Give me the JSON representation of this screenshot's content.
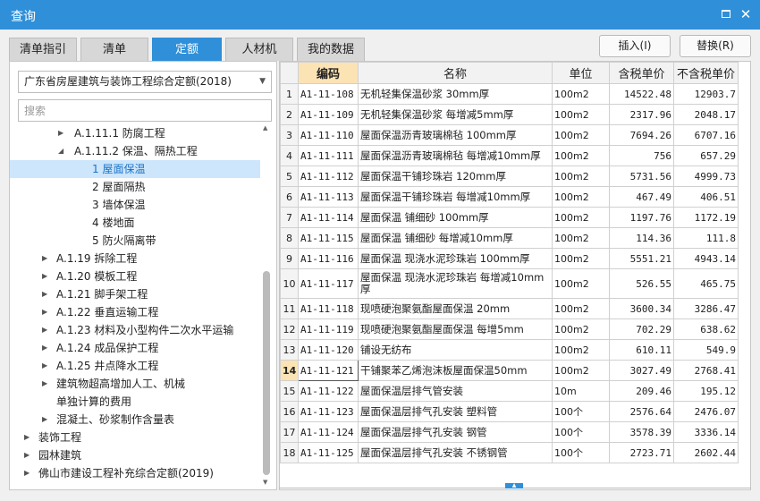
{
  "window": {
    "title": "查询"
  },
  "tabs": [
    {
      "label": "清单指引",
      "active": false
    },
    {
      "label": "清单",
      "active": false
    },
    {
      "label": "定额",
      "active": true
    },
    {
      "label": "人材机",
      "active": false
    },
    {
      "label": "我的数据",
      "active": false
    }
  ],
  "buttons": {
    "insert": "插入(I)",
    "replace": "替换(R)"
  },
  "left": {
    "quota_select": "广东省房屋建筑与装饰工程综合定额(2018)",
    "search_placeholder": "搜索"
  },
  "tree": [
    {
      "label": "A.1.11.1 防腐工程",
      "arrow": "▶"
    },
    {
      "label": "A.1.11.2 保温、隔热工程",
      "arrow": "◢"
    },
    {
      "label": "1 屋面保温",
      "arrow": "",
      "selected": true
    },
    {
      "label": "2 屋面隔热",
      "arrow": ""
    },
    {
      "label": "3 墙体保温",
      "arrow": ""
    },
    {
      "label": "4 楼地面",
      "arrow": ""
    },
    {
      "label": "5 防火隔离带",
      "arrow": ""
    },
    {
      "label": "A.1.19 拆除工程",
      "arrow": "▶"
    },
    {
      "label": "A.1.20 模板工程",
      "arrow": "▶"
    },
    {
      "label": "A.1.21 脚手架工程",
      "arrow": "▶"
    },
    {
      "label": "A.1.22 垂直运输工程",
      "arrow": "▶"
    },
    {
      "label": "A.1.23 材料及小型构件二次水平运输",
      "arrow": "▶"
    },
    {
      "label": "A.1.24 成品保护工程",
      "arrow": "▶"
    },
    {
      "label": "A.1.25 井点降水工程",
      "arrow": "▶"
    },
    {
      "label": "建筑物超高增加人工、机械",
      "arrow": "▶"
    },
    {
      "label": "单独计算的费用",
      "arrow": ""
    },
    {
      "label": "混凝土、砂浆制作含量表",
      "arrow": "▶"
    },
    {
      "label": "装饰工程",
      "arrow": "▶"
    },
    {
      "label": "园林建筑",
      "arrow": "▶"
    },
    {
      "label": "佛山市建设工程补充综合定额(2019)",
      "arrow": "▶"
    }
  ],
  "table": {
    "headers": [
      "",
      "编码",
      "名称",
      "单位",
      "含税单价",
      "不含税单价"
    ],
    "rows": [
      {
        "no": "1",
        "code": "A1-11-108",
        "name": "无机轻集保温砂浆 30mm厚",
        "unit": "100m2",
        "tax_price": "14522.48",
        "notax_price": "12903.7"
      },
      {
        "no": "2",
        "code": "A1-11-109",
        "name": "无机轻集保温砂浆 每增减5mm厚",
        "unit": "100m2",
        "tax_price": "2317.96",
        "notax_price": "2048.17"
      },
      {
        "no": "3",
        "code": "A1-11-110",
        "name": "屋面保温沥青玻璃棉毡 100mm厚",
        "unit": "100m2",
        "tax_price": "7694.26",
        "notax_price": "6707.16"
      },
      {
        "no": "4",
        "code": "A1-11-111",
        "name": "屋面保温沥青玻璃棉毡 每增减10mm厚",
        "unit": "100m2",
        "tax_price": "756",
        "notax_price": "657.29"
      },
      {
        "no": "5",
        "code": "A1-11-112",
        "name": "屋面保温干铺珍珠岩 120mm厚",
        "unit": "100m2",
        "tax_price": "5731.56",
        "notax_price": "4999.73"
      },
      {
        "no": "6",
        "code": "A1-11-113",
        "name": "屋面保温干铺珍珠岩 每增减10mm厚",
        "unit": "100m2",
        "tax_price": "467.49",
        "notax_price": "406.51"
      },
      {
        "no": "7",
        "code": "A1-11-114",
        "name": "屋面保温 铺细砂 100mm厚",
        "unit": "100m2",
        "tax_price": "1197.76",
        "notax_price": "1172.19"
      },
      {
        "no": "8",
        "code": "A1-11-115",
        "name": "屋面保温 铺细砂 每增减10mm厚",
        "unit": "100m2",
        "tax_price": "114.36",
        "notax_price": "111.8"
      },
      {
        "no": "9",
        "code": "A1-11-116",
        "name": "屋面保温 现浇水泥珍珠岩 100mm厚",
        "unit": "100m2",
        "tax_price": "5551.21",
        "notax_price": "4943.14"
      },
      {
        "no": "10",
        "code": "A1-11-117",
        "name": "屋面保温 现浇水泥珍珠岩 每增减10mm厚",
        "unit": "100m2",
        "tax_price": "526.55",
        "notax_price": "465.75"
      },
      {
        "no": "11",
        "code": "A1-11-118",
        "name": "现喷硬泡聚氨酯屋面保温 20mm",
        "unit": "100m2",
        "tax_price": "3600.34",
        "notax_price": "3286.47"
      },
      {
        "no": "12",
        "code": "A1-11-119",
        "name": "现喷硬泡聚氨酯屋面保温 每增5mm",
        "unit": "100m2",
        "tax_price": "702.29",
        "notax_price": "638.62"
      },
      {
        "no": "13",
        "code": "A1-11-120",
        "name": "铺设无纺布",
        "unit": "100m2",
        "tax_price": "610.11",
        "notax_price": "549.9"
      },
      {
        "no": "14",
        "code": "A1-11-121",
        "name": "干铺聚苯乙烯泡沫板屋面保温50mm",
        "unit": "100m2",
        "tax_price": "3027.49",
        "notax_price": "2768.41"
      },
      {
        "no": "15",
        "code": "A1-11-122",
        "name": "屋面保温层排气管安装",
        "unit": "10m",
        "tax_price": "209.46",
        "notax_price": "195.12"
      },
      {
        "no": "16",
        "code": "A1-11-123",
        "name": "屋面保温层排气孔安装 塑料管",
        "unit": "100个",
        "tax_price": "2576.64",
        "notax_price": "2476.07"
      },
      {
        "no": "17",
        "code": "A1-11-124",
        "name": "屋面保温层排气孔安装 钢管",
        "unit": "100个",
        "tax_price": "3578.39",
        "notax_price": "3336.14"
      },
      {
        "no": "18",
        "code": "A1-11-125",
        "name": "屋面保温层排气孔安装 不锈钢管",
        "unit": "100个",
        "tax_price": "2723.71",
        "notax_price": "2602.44"
      }
    ],
    "active_row": "14"
  },
  "colors": {
    "accent": "#2f8fd8",
    "header_highlight": "#fbe3b4",
    "selected_tree": "#cde6fb"
  }
}
